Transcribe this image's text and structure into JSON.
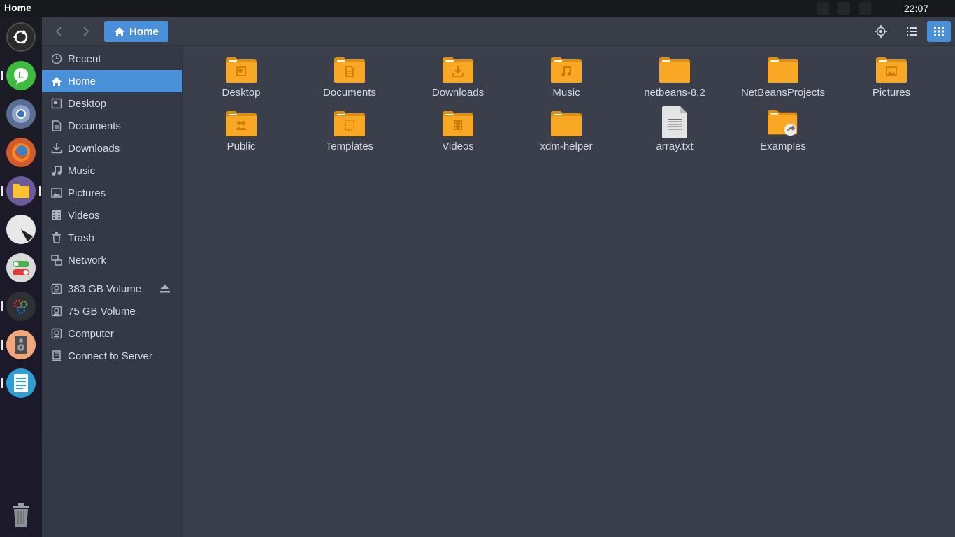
{
  "top_panel": {
    "title": "Home",
    "clock": "22:07"
  },
  "launcher": {
    "items": [
      {
        "name": "ubuntu-logo-icon",
        "color": "#2b2b2b"
      },
      {
        "name": "chat-app-icon",
        "color": "#3dba3f"
      },
      {
        "name": "chromium-icon",
        "color": "#5a6e93"
      },
      {
        "name": "firefox-icon",
        "color": "#d35a2a"
      },
      {
        "name": "files-icon",
        "color": "#6c5b9b"
      },
      {
        "name": "disc-icon",
        "color": "#e8e8e8"
      },
      {
        "name": "switches-icon",
        "color": "#dadada"
      },
      {
        "name": "settings-gears-icon",
        "color": "#2f3035"
      },
      {
        "name": "speaker-icon",
        "color": "#f2a67a"
      },
      {
        "name": "text-editor-icon",
        "color": "#2d9fd7"
      },
      {
        "name": "trash-icon",
        "color": "transparent"
      }
    ]
  },
  "headerbar": {
    "path_label": "Home"
  },
  "sidebar": {
    "items": [
      {
        "label": "Recent",
        "icon": "clock-icon"
      },
      {
        "label": "Home",
        "icon": "home-icon",
        "active": true
      },
      {
        "label": "Desktop",
        "icon": "desktop-icon"
      },
      {
        "label": "Documents",
        "icon": "document-icon"
      },
      {
        "label": "Downloads",
        "icon": "download-icon"
      },
      {
        "label": "Music",
        "icon": "music-icon"
      },
      {
        "label": "Pictures",
        "icon": "picture-icon"
      },
      {
        "label": "Videos",
        "icon": "video-icon"
      },
      {
        "label": "Trash",
        "icon": "trash-icon"
      },
      {
        "label": "Network",
        "icon": "network-icon"
      }
    ],
    "devices": [
      {
        "label": "383 GB Volume",
        "icon": "drive-icon",
        "eject": true
      },
      {
        "label": "75 GB Volume",
        "icon": "drive-icon"
      },
      {
        "label": "Computer",
        "icon": "computer-icon"
      },
      {
        "label": "Connect to Server",
        "icon": "server-icon"
      }
    ]
  },
  "files": [
    {
      "label": "Desktop",
      "type": "folder",
      "emblem": "desktop"
    },
    {
      "label": "Documents",
      "type": "folder",
      "emblem": "document"
    },
    {
      "label": "Downloads",
      "type": "folder",
      "emblem": "download"
    },
    {
      "label": "Music",
      "type": "folder",
      "emblem": "music"
    },
    {
      "label": "netbeans-8.2",
      "type": "folder",
      "emblem": ""
    },
    {
      "label": "NetBeansProjects",
      "type": "folder",
      "emblem": ""
    },
    {
      "label": "Pictures",
      "type": "folder",
      "emblem": "picture"
    },
    {
      "label": "Public",
      "type": "folder",
      "emblem": "people"
    },
    {
      "label": "Templates",
      "type": "folder",
      "emblem": "template"
    },
    {
      "label": "Videos",
      "type": "folder",
      "emblem": "video"
    },
    {
      "label": "xdm-helper",
      "type": "folder",
      "emblem": ""
    },
    {
      "label": "array.txt",
      "type": "text-file",
      "emblem": ""
    },
    {
      "label": "Examples",
      "type": "folder",
      "emblem": "link"
    }
  ],
  "colors": {
    "accent": "#4a90d9",
    "folder": "#f9a825",
    "folder_dark": "#e08e0b"
  }
}
